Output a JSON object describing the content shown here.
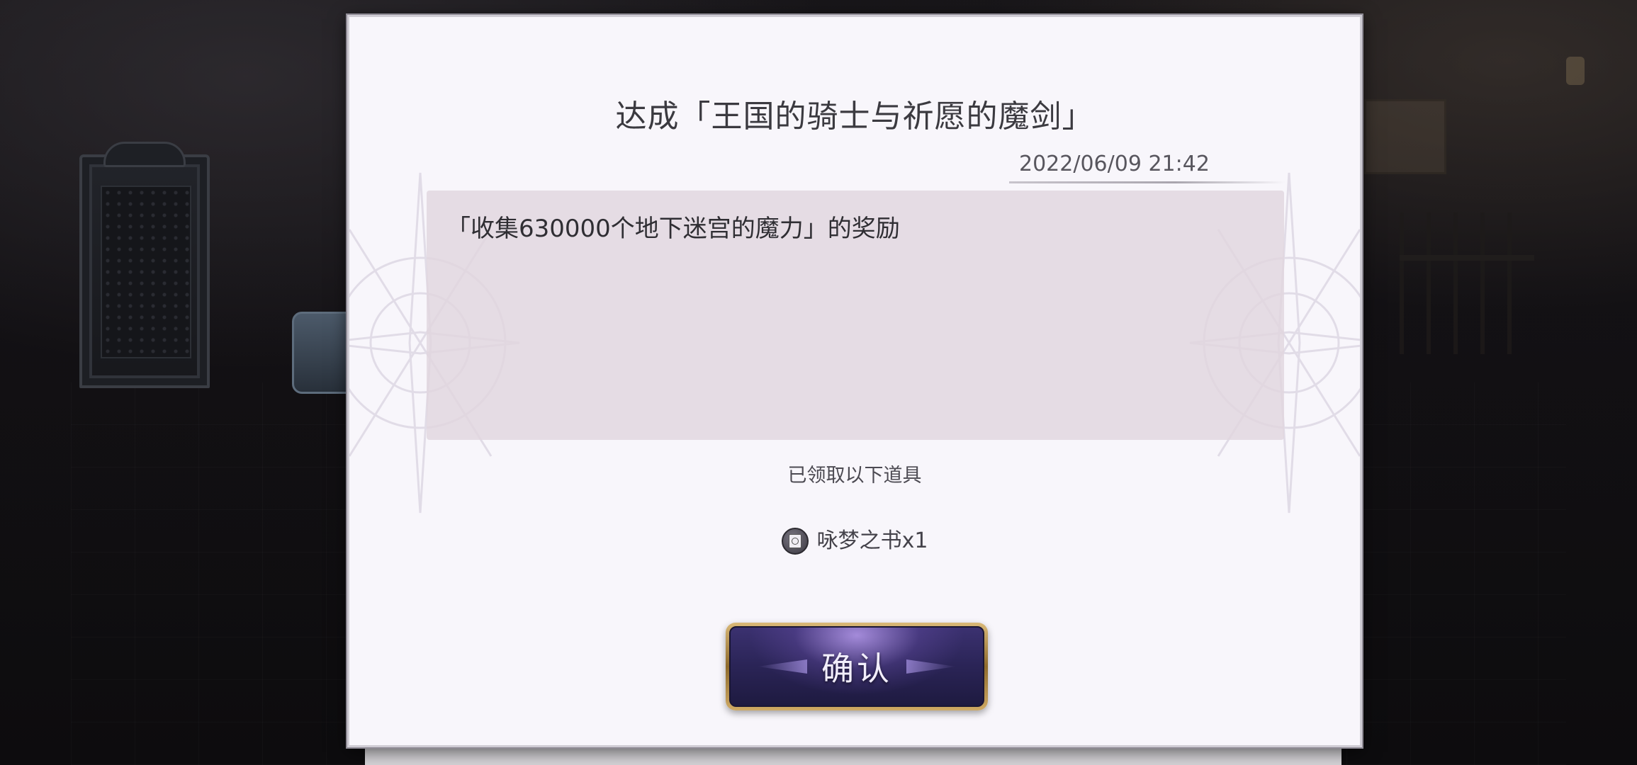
{
  "dialog": {
    "title": "达成「王国的骑士与祈愿的魔剑」",
    "timestamp": "2022/06/09 21:42",
    "message": "「收集630000个地下迷宫的魔力」的奖励",
    "received_label": "已领取以下道具",
    "rewards": [
      {
        "icon": "book-icon",
        "name": "咏梦之书x1"
      }
    ],
    "confirm_label": "确认"
  },
  "colors": {
    "dialog_background": "#f8f6fb",
    "message_box": "#e0d6de",
    "button_gold": "#d9b877",
    "button_purple": "#2a2456"
  }
}
